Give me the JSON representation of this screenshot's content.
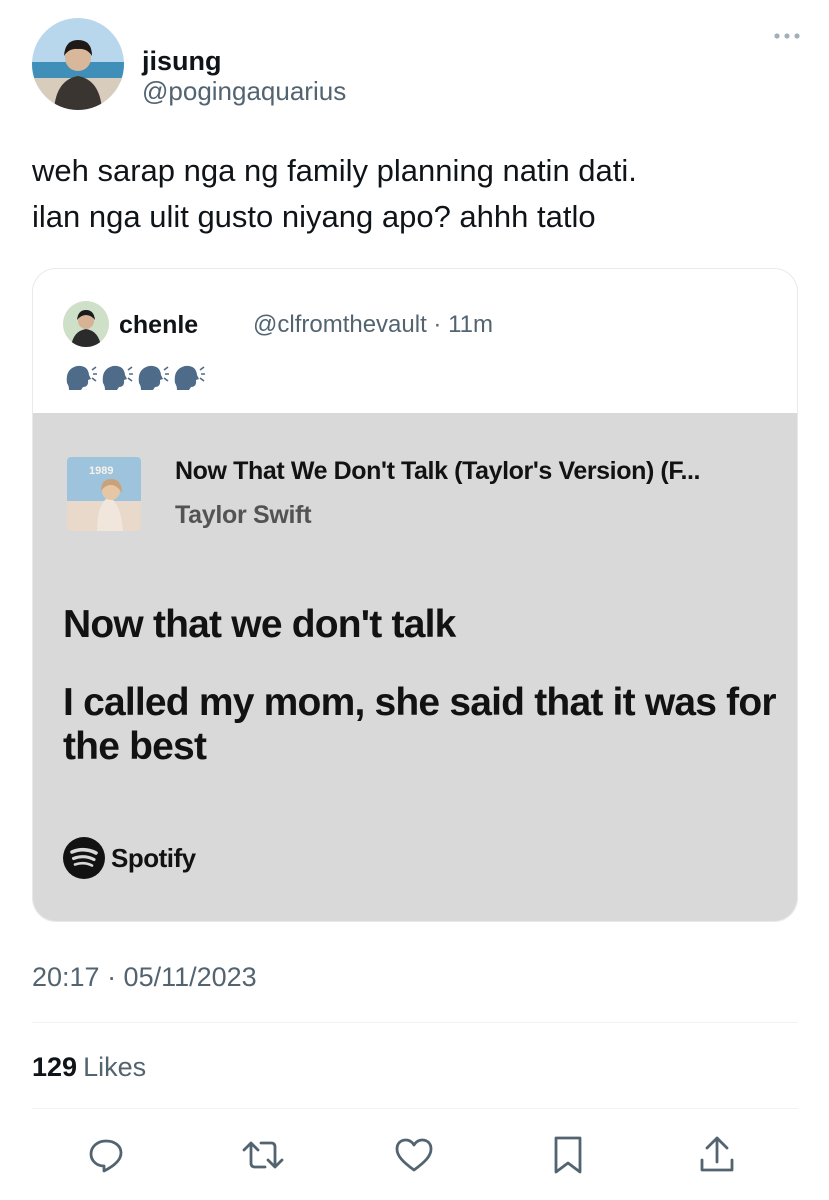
{
  "author": {
    "display_name": "jisung",
    "handle": "@pogingaquarius"
  },
  "tweet": {
    "lines": [
      "weh sarap nga ng family planning natin dati.",
      "ilan nga ulit gusto niyang apo? ahhh tatlo"
    ]
  },
  "quote": {
    "display_name": "chenle",
    "meta": "@clfromthevault · 11m",
    "emoji": "speaking-head x4",
    "spotify": {
      "album_label": "1989",
      "song_title": "Now That We Don't Talk (Taylor's Version) (F...",
      "artist": "Taylor Swift",
      "lyrics": [
        "Now that we don't talk",
        "I called my mom, she said that it was for the best"
      ],
      "brand": "Spotify",
      "brand_color": "#121212"
    }
  },
  "timestamp": "20:17 · 05/11/2023",
  "stats": {
    "likes_count": "129",
    "likes_label": "Likes"
  },
  "actions": [
    "reply-icon",
    "retweet-icon",
    "like-icon",
    "bookmark-icon",
    "share-icon"
  ],
  "colors": {
    "text": "#0f1419",
    "secondary": "#536471",
    "card_bg": "#d9d9d9"
  }
}
